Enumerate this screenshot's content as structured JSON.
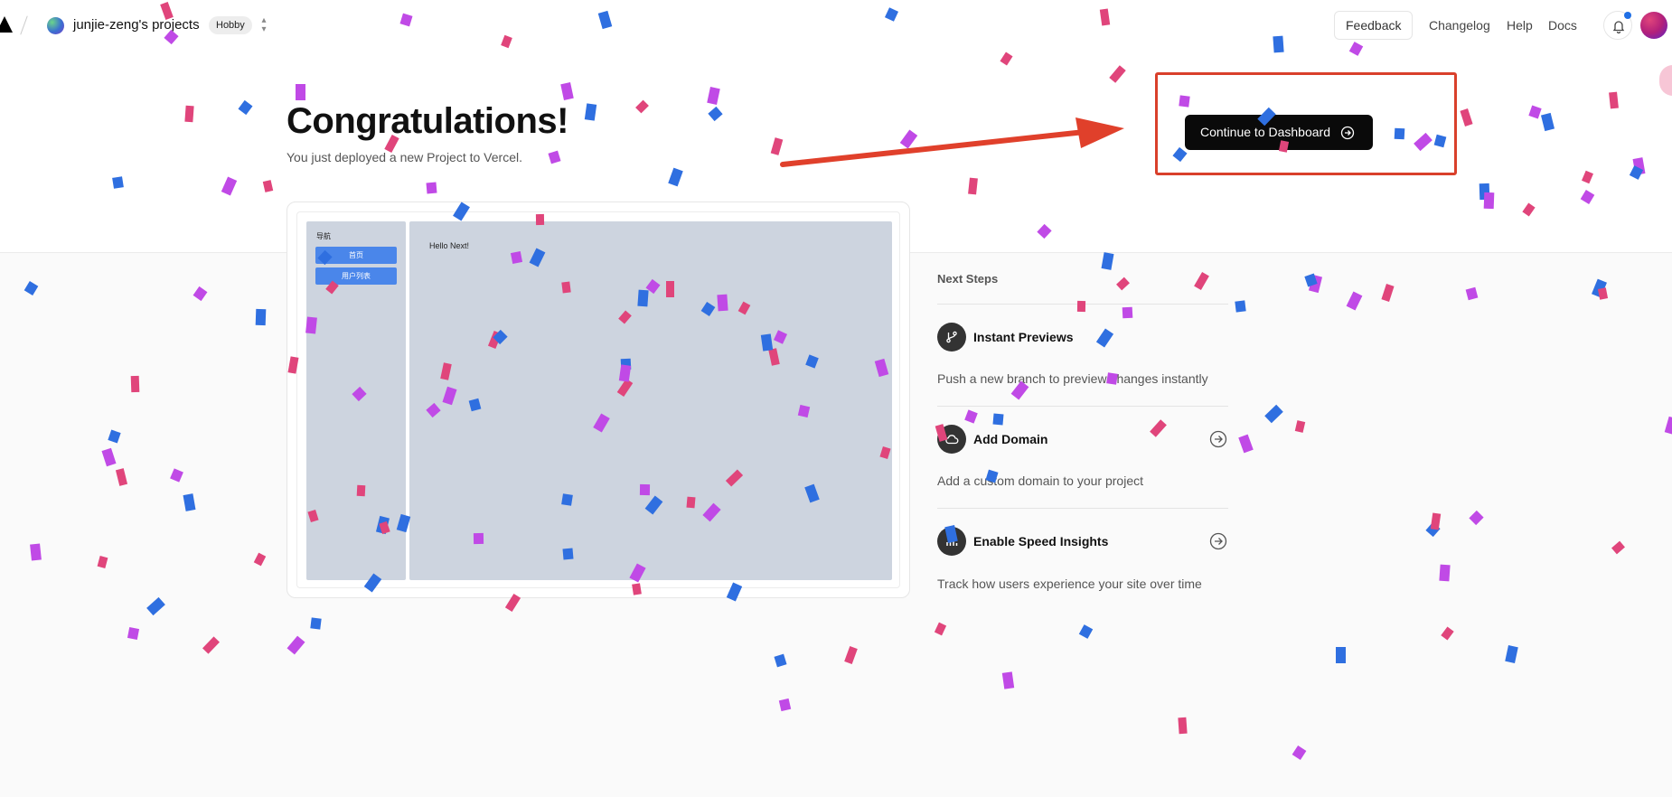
{
  "header": {
    "team_name": "junjie-zeng's projects",
    "plan_badge": "Hobby",
    "feedback_label": "Feedback",
    "nav": [
      "Changelog",
      "Help",
      "Docs"
    ]
  },
  "hero": {
    "title": "Congratulations!",
    "subtitle": "You just deployed a new Project to Vercel.",
    "continue_label": "Continue to Dashboard"
  },
  "preview": {
    "nav_title": "导航",
    "nav_buttons": [
      "首页",
      "用户列表"
    ],
    "main_text": "Hello Next!"
  },
  "next_steps": {
    "title": "Next Steps",
    "items": [
      {
        "title": "Instant Previews",
        "description": "Push a new branch to preview changes instantly",
        "icon": "git-branch-icon"
      },
      {
        "title": "Add Domain",
        "description": "Add a custom domain to your project",
        "icon": "cloud-icon"
      },
      {
        "title": "Enable Speed Insights",
        "description": "Track how users experience your site over time",
        "icon": "bar-chart-icon"
      }
    ]
  },
  "colors": {
    "confetti": [
      "#e0457b",
      "#c04ae6",
      "#2f6fe0"
    ],
    "annotation": "#d9402b"
  }
}
